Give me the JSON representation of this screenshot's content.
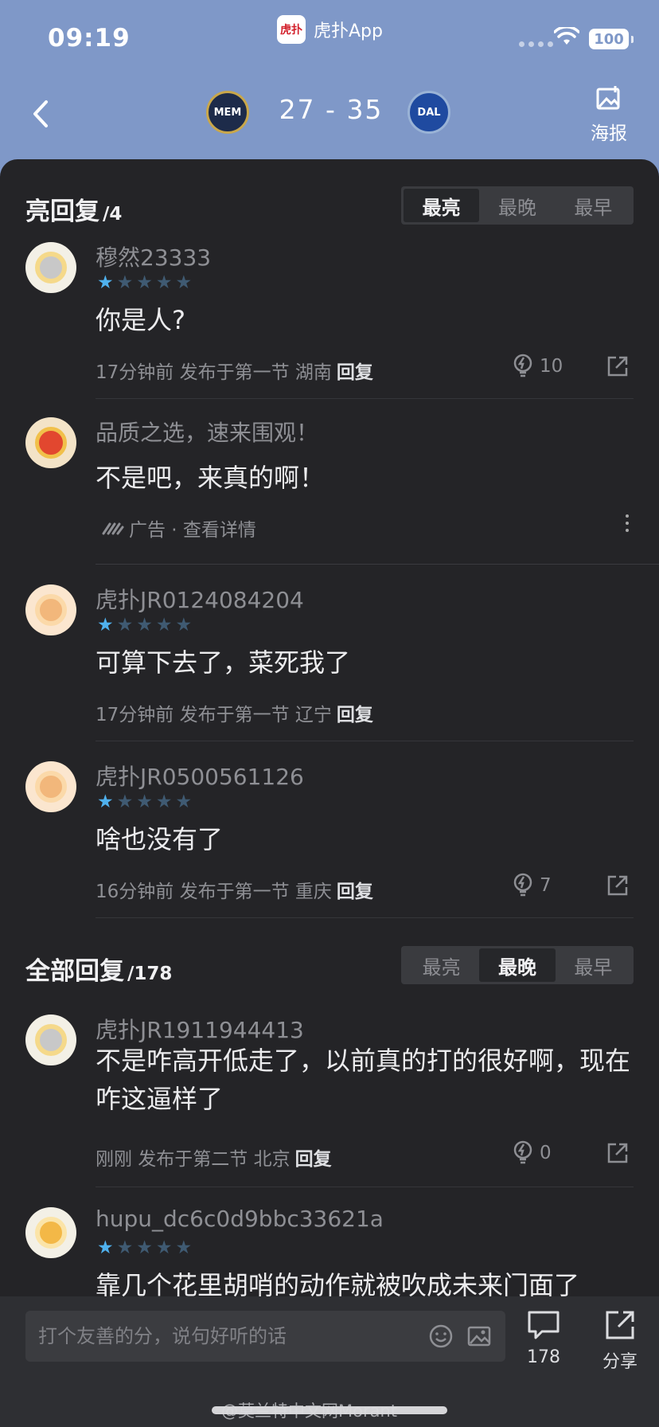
{
  "status_bar": {
    "time": "09:19",
    "app_name": "虎扑App",
    "app_logo_text": "虎扑",
    "battery": "100"
  },
  "game": {
    "home_team": "MEM",
    "away_team": "DAL",
    "score": "27 - 35",
    "poster_label": "海报"
  },
  "hot_replies": {
    "title": "亮回复",
    "count": "/4",
    "sort_options": [
      "最亮",
      "最晚",
      "最早"
    ],
    "active_sort": "最亮"
  },
  "comments": [
    {
      "username": "穆然23333",
      "rating": 1,
      "content": "你是人?",
      "meta": "17分钟前 发布于第一节 湖南",
      "reply_label": "回复",
      "light_count": "10"
    },
    {
      "username": "虎扑JR0124084204",
      "rating": 1,
      "content": "可算下去了，菜死我了",
      "meta": "17分钟前 发布于第一节 辽宁",
      "reply_label": "回复"
    },
    {
      "username": "虎扑JR0500561126",
      "rating": 1,
      "content": "啥也没有了",
      "meta": "16分钟前 发布于第一节 重庆",
      "reply_label": "回复",
      "light_count": "7"
    }
  ],
  "ad": {
    "title": "品质之选，速来围观！",
    "content": "不是吧，来真的啊！",
    "label": "广告 · 查看详情"
  },
  "all_replies": {
    "title": "全部回复",
    "count": "/178",
    "sort_options": [
      "最亮",
      "最晚",
      "最早"
    ],
    "active_sort": "最晚",
    "comments": [
      {
        "username": "虎扑JR1911944413",
        "content": "不是咋高开低走了，以前真的打的很好啊，现在咋这逼样了",
        "meta": "刚刚 发布于第二节 北京",
        "reply_label": "回复",
        "light_count": "0"
      },
      {
        "username": "hupu_dc6c0d9bbc33621a",
        "rating": 1,
        "content": "靠几个花里胡哨的动作就被吹成未来门面了"
      }
    ]
  },
  "bottom_bar": {
    "input_placeholder": "打个友善的分，说句好听的话",
    "comment_count": "178",
    "share_label": "分享"
  },
  "watermark": "@莫兰特中文网Morant",
  "colors": {
    "header_bg": "#7f98c8",
    "panel_bg": "#242427",
    "star_active": "#4fb1ee",
    "star_inactive": "#3f5a72"
  }
}
